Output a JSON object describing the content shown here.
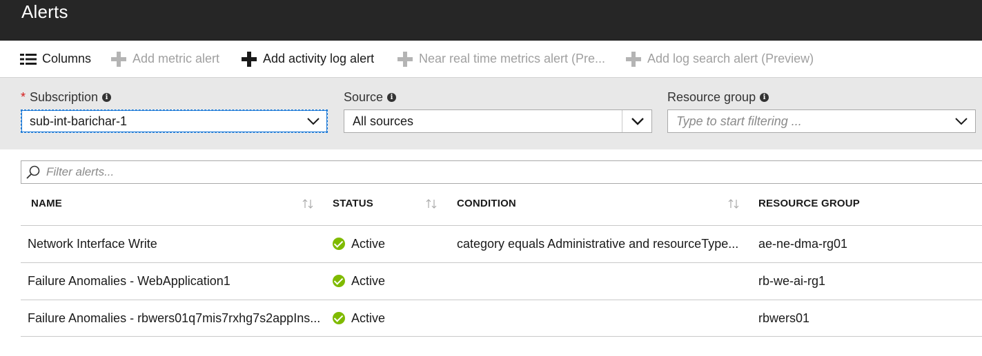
{
  "header": {
    "title": "Alerts"
  },
  "toolbar": {
    "columns_label": "Columns",
    "add_metric_alert": "Add metric alert",
    "add_activity_log_alert": "Add activity log alert",
    "near_real_time": "Near real time metrics alert (Pre...",
    "add_log_search": "Add log search alert (Preview)"
  },
  "filters": {
    "subscription": {
      "label": "Subscription",
      "required_mark": "*",
      "value": "sub-int-barichar-1"
    },
    "source": {
      "label": "Source",
      "value": "All sources"
    },
    "resource_group": {
      "label": "Resource group",
      "placeholder": "Type to start filtering ..."
    }
  },
  "search": {
    "placeholder": "Filter alerts..."
  },
  "table": {
    "columns": [
      "NAME",
      "STATUS",
      "CONDITION",
      "RESOURCE GROUP"
    ],
    "rows": [
      {
        "name": "Network Interface Write",
        "status": "Active",
        "condition": "category equals Administrative and resourceType...",
        "resource_group": "ae-ne-dma-rg01"
      },
      {
        "name": "Failure Anomalies - WebApplication1",
        "status": "Active",
        "condition": "",
        "resource_group": "rb-we-ai-rg1"
      },
      {
        "name": "Failure Anomalies - rbwers01q7mis7rxhg7s2appIns...",
        "status": "Active",
        "condition": "",
        "resource_group": "rbwers01"
      }
    ]
  },
  "colors": {
    "header_bg": "#262626",
    "filter_bg": "#e8e8e8",
    "status_green": "#7fba00",
    "required_red": "#d41b1b",
    "focus_blue": "#1e7ad6"
  },
  "icons": [
    "columns-icon",
    "plus-icon",
    "info-icon",
    "chevron-down-icon",
    "search-icon",
    "sort-icon",
    "check-circle-icon"
  ]
}
